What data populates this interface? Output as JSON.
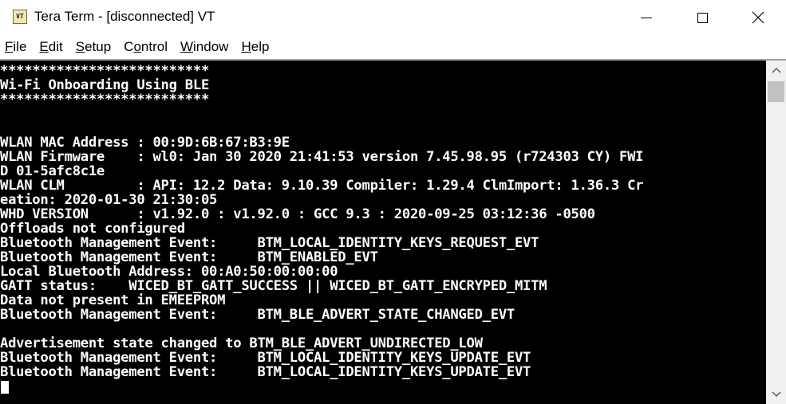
{
  "window": {
    "title": "Tera Term - [disconnected] VT",
    "icon_text": "VT"
  },
  "menu": [
    {
      "hotkey": "F",
      "rest": "ile"
    },
    {
      "hotkey": "E",
      "rest": "dit"
    },
    {
      "hotkey": "S",
      "rest": "etup"
    },
    {
      "prefix": "C",
      "hotkey": "o",
      "rest": "ntrol"
    },
    {
      "hotkey": "W",
      "rest": "indow"
    },
    {
      "hotkey": "H",
      "rest": "elp"
    }
  ],
  "terminal": {
    "lines": [
      "**************************",
      "Wi-Fi Onboarding Using BLE",
      "**************************",
      "",
      "",
      "WLAN MAC Address : 00:9D:6B:67:B3:9E",
      "WLAN Firmware    : wl0: Jan 30 2020 21:41:53 version 7.45.98.95 (r724303 CY) FWI",
      "D 01-5afc8c1e",
      "WLAN CLM         : API: 12.2 Data: 9.10.39 Compiler: 1.29.4 ClmImport: 1.36.3 Cr",
      "eation: 2020-01-30 21:30:05",
      "WHD VERSION      : v1.92.0 : v1.92.0 : GCC 9.3 : 2020-09-25 03:12:36 -0500",
      "Offloads not configured",
      "Bluetooth Management Event:     BTM_LOCAL_IDENTITY_KEYS_REQUEST_EVT",
      "Bluetooth Management Event:     BTM_ENABLED_EVT",
      "Local Bluetooth Address: 00:A0:50:00:00:00",
      "GATT status:    WICED_BT_GATT_SUCCESS || WICED_BT_GATT_ENCRYPED_MITM",
      "Data not present in EMEEPROM",
      "Bluetooth Management Event:     BTM_BLE_ADVERT_STATE_CHANGED_EVT",
      "",
      "Advertisement state changed to BTM_BLE_ADVERT_UNDIRECTED_LOW",
      "Bluetooth Management Event:     BTM_LOCAL_IDENTITY_KEYS_UPDATE_EVT",
      "Bluetooth Management Event:     BTM_LOCAL_IDENTITY_KEYS_UPDATE_EVT"
    ]
  },
  "colors": {
    "terminal_bg": "#000000",
    "terminal_fg": "#ffffff"
  },
  "icons": {
    "minimize": "minimize-icon",
    "maximize": "maximize-icon",
    "close": "close-icon",
    "scroll_up": "chevron-up-icon",
    "scroll_down": "chevron-down-icon"
  }
}
